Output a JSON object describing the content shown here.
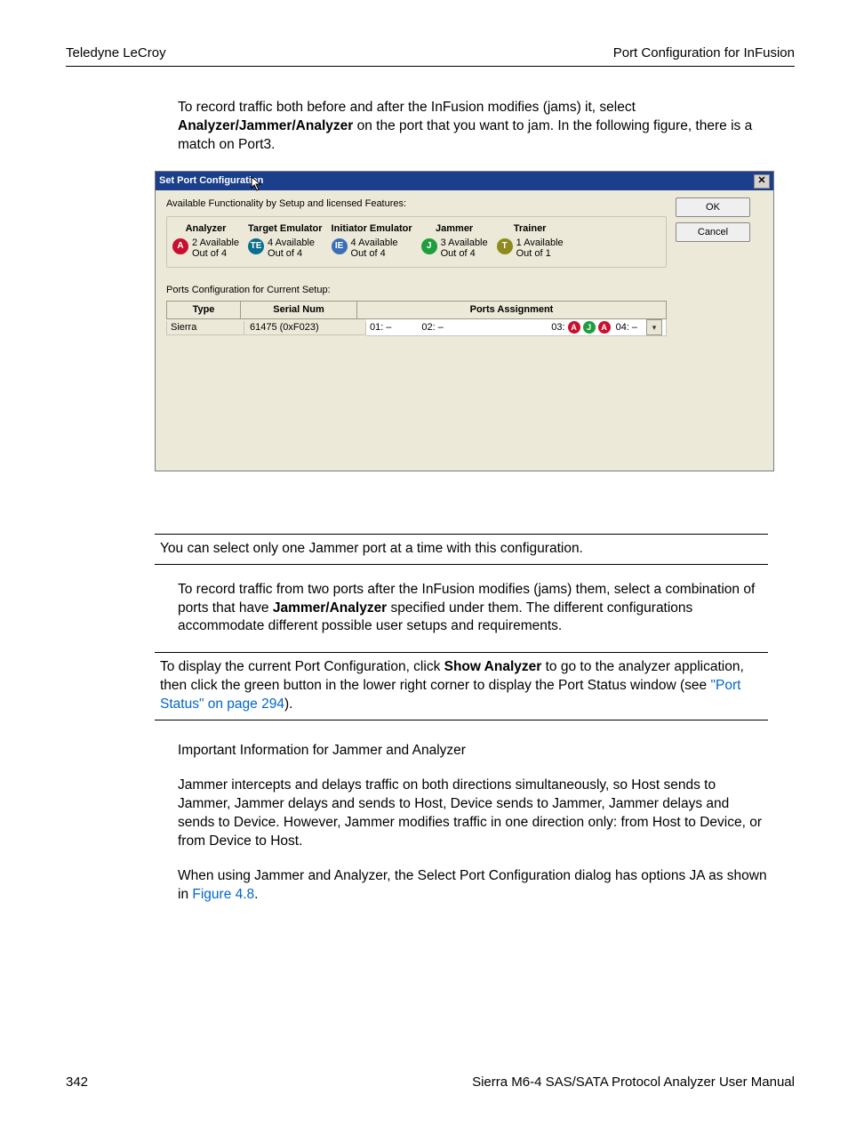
{
  "header": {
    "left": "Teledyne LeCroy",
    "right": "Port Configuration for InFusion"
  },
  "para1_pre": "To record traffic both before and after the InFusion modifies (jams) it, select ",
  "para1_bold": "Analyzer/Jammer/Analyzer",
  "para1_post": " on the port that you want to jam. In the following figure, there is a match on Port3.",
  "win": {
    "title": "Set Port Configuration",
    "ok": "OK",
    "cancel": "Cancel",
    "avail": "Available Functionality by Setup and licensed Features:",
    "cards": {
      "analyzer": {
        "head": "Analyzer",
        "line1": "2 Available",
        "line2": "Out of 4",
        "glyph": "A"
      },
      "target": {
        "head": "Target Emulator",
        "line1": "4 Available",
        "line2": "Out of 4",
        "glyph": "TE"
      },
      "initiator": {
        "head": "Initiator Emulator",
        "line1": "4 Available",
        "line2": "Out of 4",
        "glyph": "IE"
      },
      "jammer": {
        "head": "Jammer",
        "line1": "3 Available",
        "line2": "Out of 4",
        "glyph": "J"
      },
      "trainer": {
        "head": "Trainer",
        "line1": "1 Available",
        "line2": "Out of 1",
        "glyph": "T"
      }
    },
    "sub": "Ports Configuration for Current Setup:",
    "cols": {
      "type": "Type",
      "sn": "Serial Num",
      "pa": "Ports Assignment"
    },
    "row": {
      "type": "Sierra",
      "sn": "61475 (0xF023)",
      "p1": "01:",
      "p2": "02:",
      "p3": "03:",
      "p4": "04:",
      "dash": "–"
    }
  },
  "note1": "You can select only one Jammer port at a time with this configuration.",
  "para2_pre": "To record traffic from two ports after the InFusion modifies (jams) them, select a combination of ports that have ",
  "para2_bold": "Jammer/Analyzer",
  "para2_post": " specified under them. The different configurations accommodate different possible user setups and requirements.",
  "note2_pre": "To display the current Port Configuration, click ",
  "note2_bold": "Show Analyzer",
  "note2_mid": " to go to the analyzer application, then click the green button in the lower right corner to display the Port Status window (see ",
  "note2_link": "\"Port Status\" on page 294",
  "note2_post": ").",
  "para3_head": "Important Information for Jammer and Analyzer",
  "para3_body": "Jammer intercepts and delays traffic on both directions simultaneously, so Host sends to Jammer, Jammer delays and sends to Host, Device sends to Jammer, Jammer delays and sends to Device. However, Jammer modifies traffic in one direction only: from Host to Device, or from Device to Host.",
  "para4_pre": "When using Jammer and Analyzer, the Select Port Configuration dialog has options JA as shown in ",
  "para4_link": "Figure 4.8",
  "para4_post": ".",
  "footer": {
    "page": "342",
    "title": "Sierra M6-4 SAS/SATA Protocol Analyzer User Manual"
  }
}
